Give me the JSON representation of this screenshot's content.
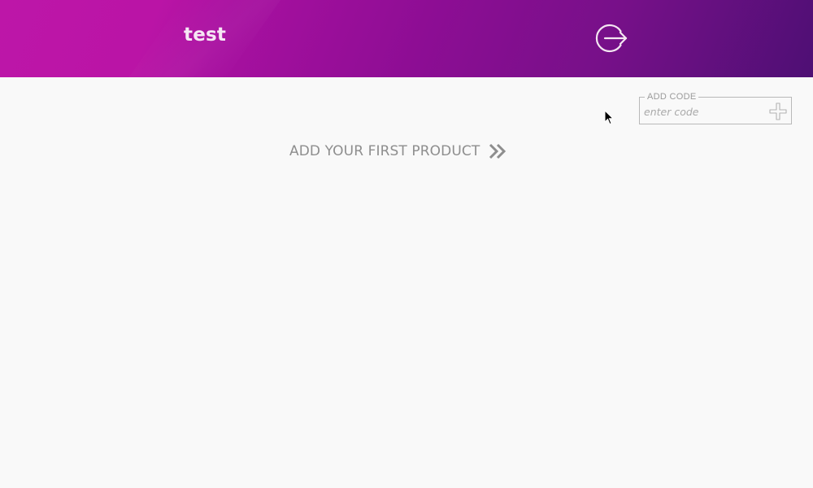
{
  "header": {
    "title": "test",
    "logout_icon": "logout-icon",
    "colors": {
      "gradient_start": "#bd16a8",
      "gradient_end": "#4e0f74",
      "title_text": "#f6e7f4"
    }
  },
  "code_field": {
    "legend": "ADD CODE",
    "placeholder": "enter code",
    "value": "",
    "add_icon": "plus-icon"
  },
  "main": {
    "empty_cta_label": "ADD YOUR FIRST PRODUCT",
    "cta_icon": "double-chevron-right-icon"
  },
  "colors": {
    "background": "#f9f9f9",
    "muted_text": "#8e8e8e"
  }
}
